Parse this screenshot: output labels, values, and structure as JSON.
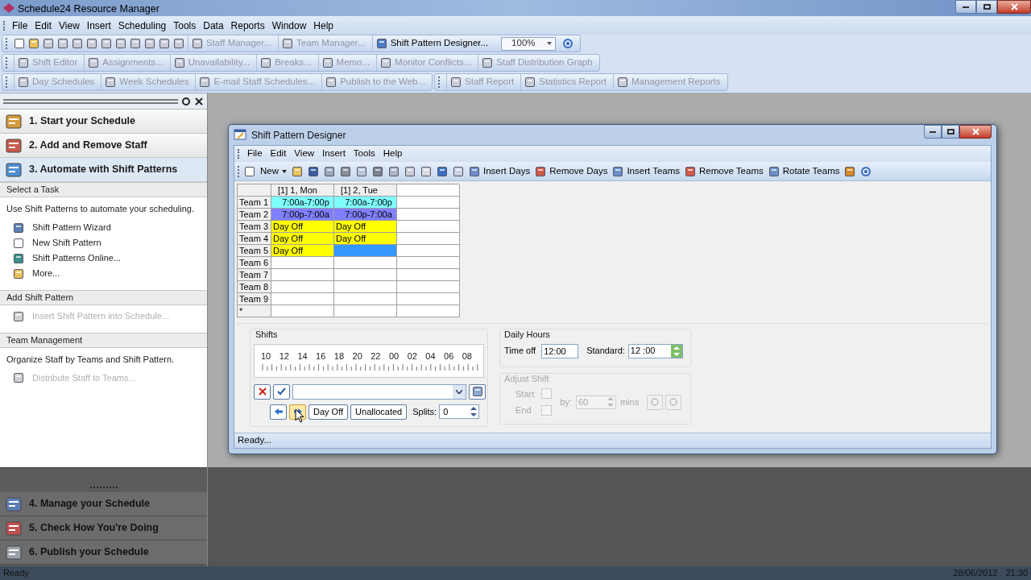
{
  "app_window": {
    "title": "Schedule24 Resource Manager"
  },
  "menu": [
    "File",
    "Edit",
    "View",
    "Insert",
    "Scheduling",
    "Tools",
    "Data",
    "Reports",
    "Window",
    "Help"
  ],
  "toolbars": [
    [
      {
        "label": "Staff Manager...",
        "disabled": true
      },
      {
        "label": "Team Manager...",
        "disabled": true
      },
      {
        "label": "Shift Pattern Designer...",
        "disabled": false
      }
    ],
    [
      {
        "label": "Shift Editor",
        "disabled": true
      },
      {
        "label": "Assignments...",
        "disabled": true
      },
      {
        "label": "Unavailability...",
        "disabled": true
      },
      {
        "label": "Breaks...",
        "disabled": true
      },
      {
        "label": "Memo...",
        "disabled": true
      },
      {
        "label": "Monitor Conflicts...",
        "disabled": true
      },
      {
        "label": "Staff Distribution Graph",
        "disabled": true
      }
    ],
    [
      {
        "label": "Day Schedules",
        "disabled": true
      },
      {
        "label": "Week Schedules",
        "disabled": true
      },
      {
        "label": "E-mail Staff Schedules...",
        "disabled": true
      },
      {
        "label": "Publish to the Web...",
        "disabled": true
      },
      {
        "label": "Staff Report",
        "disabled": true
      },
      {
        "label": "Statistics Report",
        "disabled": true
      },
      {
        "label": "Management Reports",
        "disabled": true
      }
    ]
  ],
  "zoom": "100%",
  "task_pane": {
    "steps_top": [
      {
        "label": "1. Start your Schedule",
        "selected": false
      },
      {
        "label": "2. Add and Remove Staff",
        "selected": false
      },
      {
        "label": "3. Automate with Shift Patterns",
        "selected": true
      }
    ],
    "sections": [
      {
        "title": "Select a Task",
        "description": "Use Shift Patterns to automate your scheduling.",
        "links": [
          {
            "label": "Shift Pattern Wizard",
            "disabled": false
          },
          {
            "label": "New Shift Pattern",
            "disabled": false
          },
          {
            "label": "Shift Patterns Online...",
            "disabled": false
          },
          {
            "label": "More...",
            "disabled": false
          }
        ]
      },
      {
        "title": "Add Shift Pattern",
        "links": [
          {
            "label": "Insert Shift Pattern into Schedule...",
            "disabled": true
          }
        ]
      },
      {
        "title": "Team Management",
        "description": "Organize Staff by Teams and Shift Pattern.",
        "links": [
          {
            "label": "Distribute Staff to Teams...",
            "disabled": true
          }
        ]
      }
    ],
    "steps_bottom": [
      {
        "label": "4. Manage your Schedule",
        "selected": false
      },
      {
        "label": "5. Check How You're Doing",
        "selected": false
      },
      {
        "label": "6. Publish your Schedule",
        "selected": false
      }
    ]
  },
  "designer": {
    "title": "Shift Pattern Designer",
    "menu": [
      "File",
      "Edit",
      "View",
      "Insert",
      "Tools",
      "Help"
    ],
    "toolbar": [
      "New",
      "Insert Days",
      "Remove Days",
      "Insert Teams",
      "Remove Teams",
      "Rotate Teams"
    ],
    "grid": {
      "columns": [
        "[1] 1, Mon",
        "[1] 2, Tue"
      ],
      "rows": [
        {
          "label": "Team 1",
          "cells": [
            {
              "kind": "shift",
              "text": "7:00a-7:00p",
              "color": "#80ffff"
            },
            {
              "kind": "shift",
              "text": "7:00a-7:00p",
              "color": "#80ffff"
            }
          ]
        },
        {
          "label": "Team 2",
          "cells": [
            {
              "kind": "shift",
              "text": "7:00p-7:00a",
              "color": "#8080ff"
            },
            {
              "kind": "shift",
              "text": "7:00p-7:00a",
              "color": "#8080ff"
            }
          ]
        },
        {
          "label": "Team 3",
          "cells": [
            {
              "kind": "day_off",
              "text": "Day Off",
              "color": "#ffff00"
            },
            {
              "kind": "day_off",
              "text": "Day Off",
              "color": "#ffff00"
            }
          ]
        },
        {
          "label": "Team 4",
          "cells": [
            {
              "kind": "day_off",
              "text": "Day Off",
              "color": "#ffff00"
            },
            {
              "kind": "day_off",
              "text": "Day Off",
              "color": "#ffff00"
            }
          ]
        },
        {
          "label": "Team 5",
          "cells": [
            {
              "kind": "day_off",
              "text": "Day Off",
              "color": "#ffff00"
            },
            {
              "kind": "fill",
              "color": "#3399ff"
            }
          ]
        },
        {
          "label": "Team 6",
          "cells": []
        },
        {
          "label": "Team 7",
          "cells": []
        },
        {
          "label": "Team 8",
          "cells": []
        },
        {
          "label": "Team 9",
          "cells": []
        }
      ],
      "new_row": "*"
    },
    "shifts": {
      "title": "Shifts",
      "ticks": [
        "10",
        "12",
        "14",
        "16",
        "18",
        "20",
        "22",
        "00",
        "02",
        "04",
        "06",
        "08"
      ],
      "buttons": [
        "Day Off",
        "Unallocated"
      ],
      "splits_label": "Splits:",
      "splits_value": "0"
    },
    "daily_hours": {
      "title": "Daily Hours",
      "time_off_label": "Time off",
      "time_off_value": "12:00",
      "standard_label": "Standard:",
      "standard_value": "12 :00"
    },
    "adjust_shift": {
      "title": "Adjust Shift",
      "disabled": true,
      "start_label": "Start",
      "end_label": "End",
      "by_label": "by:",
      "by_value": "60",
      "mins_label": "mins"
    },
    "status": "Ready..."
  },
  "status_bar": {
    "text": "Ready",
    "date": "28/06/2012",
    "time": "21:30"
  }
}
